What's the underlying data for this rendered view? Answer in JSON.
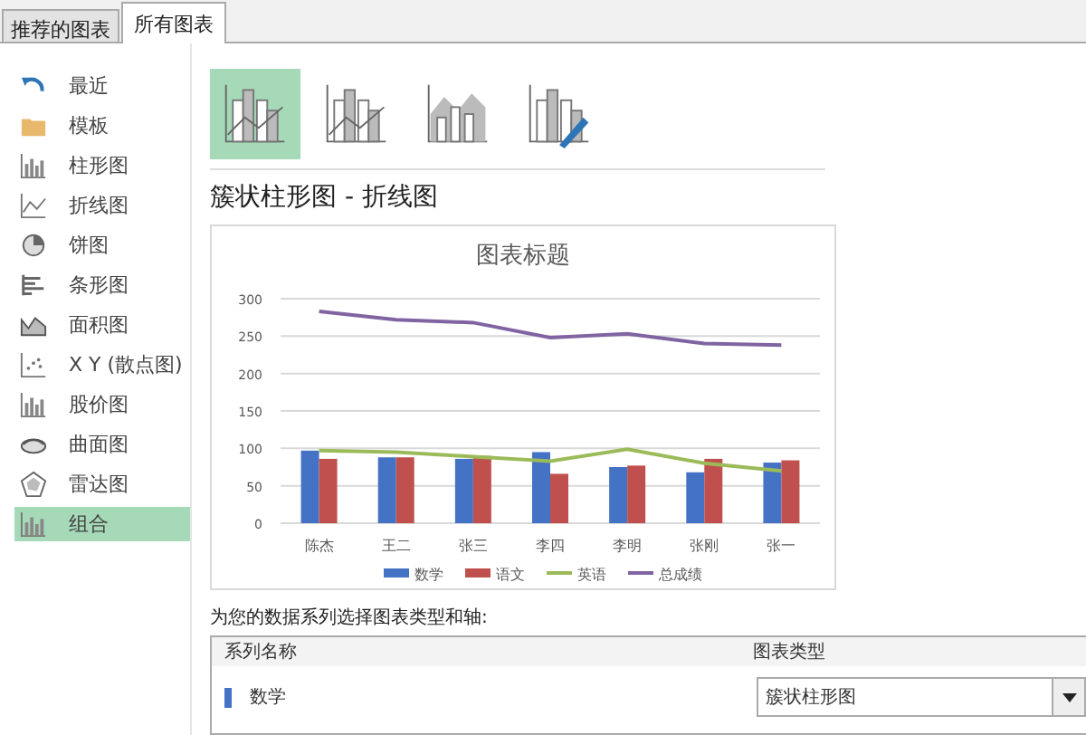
{
  "tabs": [
    {
      "label": "推荐的图表",
      "selected": false
    },
    {
      "label": "所有图表",
      "selected": true
    }
  ],
  "sidebar": {
    "items": [
      {
        "label": "最近",
        "selected": false
      },
      {
        "label": "模板",
        "selected": false
      },
      {
        "label": "柱形图",
        "selected": false
      },
      {
        "label": "折线图",
        "selected": false
      },
      {
        "label": "饼图",
        "selected": false
      },
      {
        "label": "条形图",
        "selected": false
      },
      {
        "label": "面积图",
        "selected": false
      },
      {
        "label": "X Y (散点图)",
        "selected": false
      },
      {
        "label": "股价图",
        "selected": false
      },
      {
        "label": "曲面图",
        "selected": false
      },
      {
        "label": "雷达图",
        "selected": false
      },
      {
        "label": "组合",
        "selected": true
      }
    ]
  },
  "subtypes": [
    {
      "selected": true
    },
    {
      "selected": false
    },
    {
      "selected": false
    },
    {
      "selected": false
    }
  ],
  "heading": "簇状柱形图 - 折线图",
  "chart": {
    "chart_data": {
      "type": "bar",
      "title": "图表标题",
      "grid": true,
      "legend": "bottom",
      "categories": [
        "陈杰",
        "王二",
        "张三",
        "李四",
        "李明",
        "张刚",
        "张一"
      ],
      "ylim": [
        0,
        300
      ],
      "yticks": [
        0,
        50,
        100,
        150,
        200,
        250,
        300
      ],
      "series": [
        {
          "name": "数学",
          "color": "#4472c4",
          "values": [
            97,
            88,
            86,
            95,
            75,
            68,
            81
          ]
        },
        {
          "name": "语文",
          "color": "#c0504d",
          "values": [
            86,
            88,
            90,
            66,
            77,
            86,
            84
          ]
        },
        {
          "name": "英语",
          "color": "#9bbb59",
          "type": "line",
          "values": [
            97,
            95,
            89,
            83,
            99,
            80,
            70
          ]
        },
        {
          "name": "总成绩",
          "color": "#8064a2",
          "type": "line",
          "values": [
            283,
            272,
            268,
            248,
            253,
            240,
            238
          ]
        }
      ]
    }
  },
  "series_prompt": "为您的数据系列选择图表类型和轴:",
  "series_table": {
    "columns": [
      "系列名称",
      "图表类型"
    ],
    "rows": [
      {
        "name": "数学",
        "color": "#4472c4",
        "chart_type": "簇状柱形图"
      }
    ]
  }
}
